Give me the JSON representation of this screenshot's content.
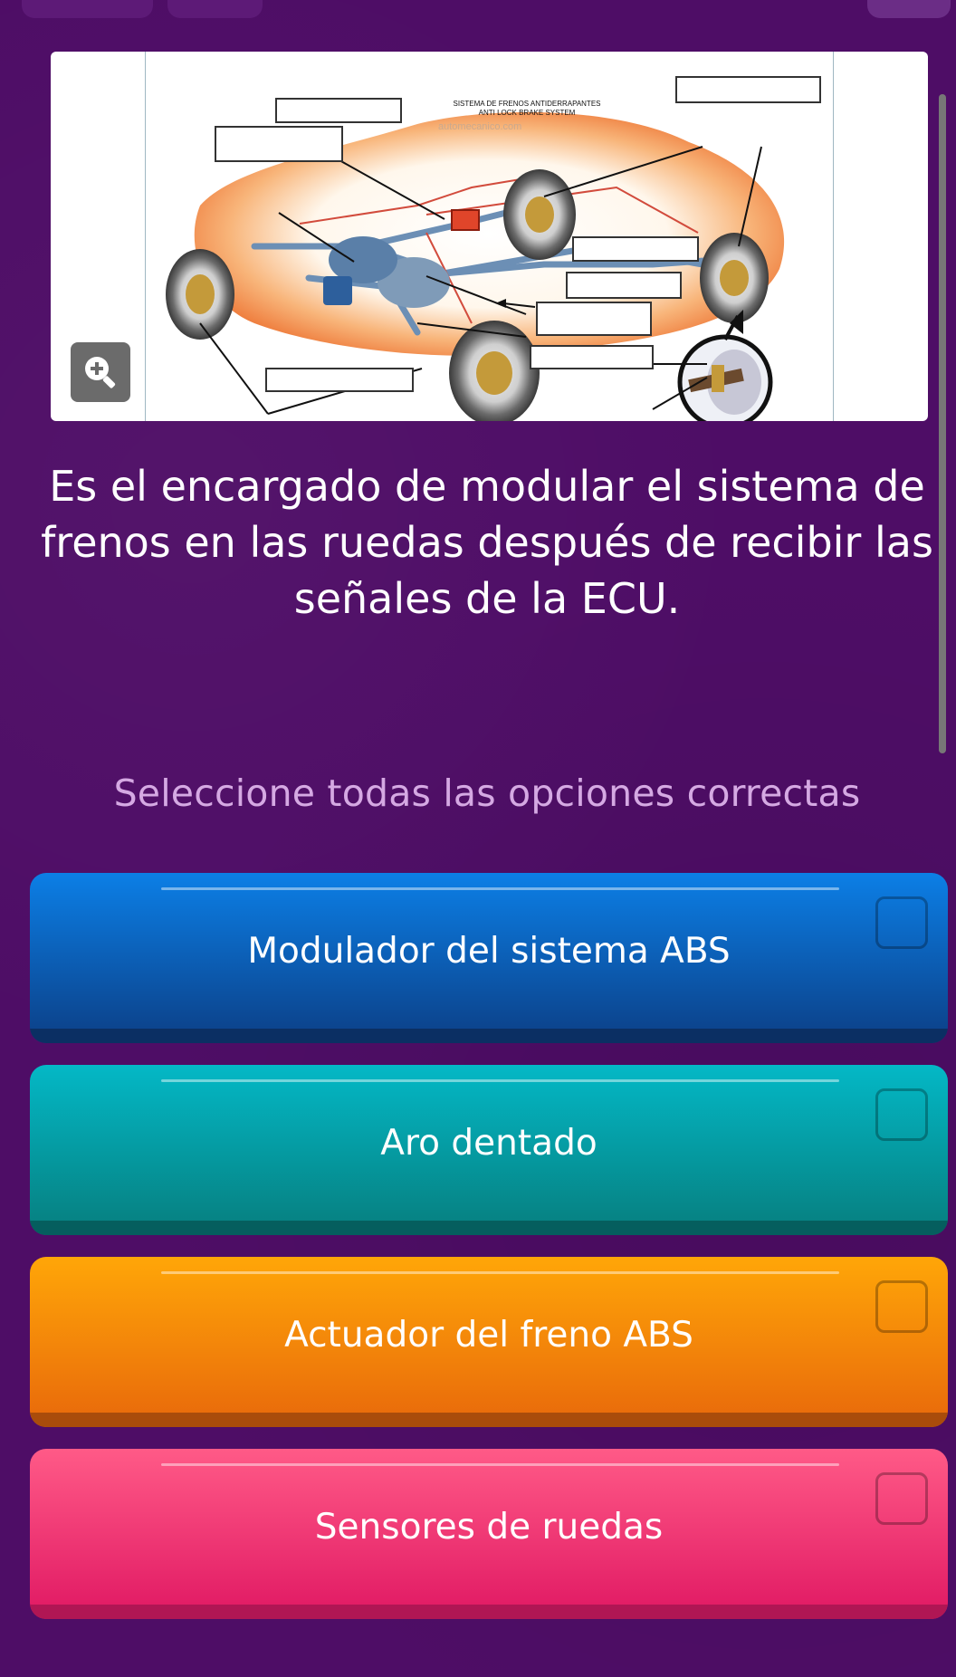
{
  "image": {
    "title_line1": "SISTEMA DE FRENOS ANTIDERRAPANTES",
    "title_line2": "ANTI LOCK BRAKE SYSTEM",
    "watermark": "automecanico.com",
    "zoom_icon": "zoom-in-icon"
  },
  "question": {
    "text": "Es el encargado de modular el sistema de frenos en las ruedas después de recibir las señales de la ECU."
  },
  "instruction": "Seleccione todas las opciones correctas",
  "options": [
    {
      "label": "Modulador del sistema ABS",
      "color": "#0c7fe6"
    },
    {
      "label": "Aro dentado",
      "color": "#04b8c6"
    },
    {
      "label": "Actuador del freno ABS",
      "color": "#ffa608"
    },
    {
      "label": "Sensores de ruedas",
      "color": "#ff5a87"
    }
  ]
}
